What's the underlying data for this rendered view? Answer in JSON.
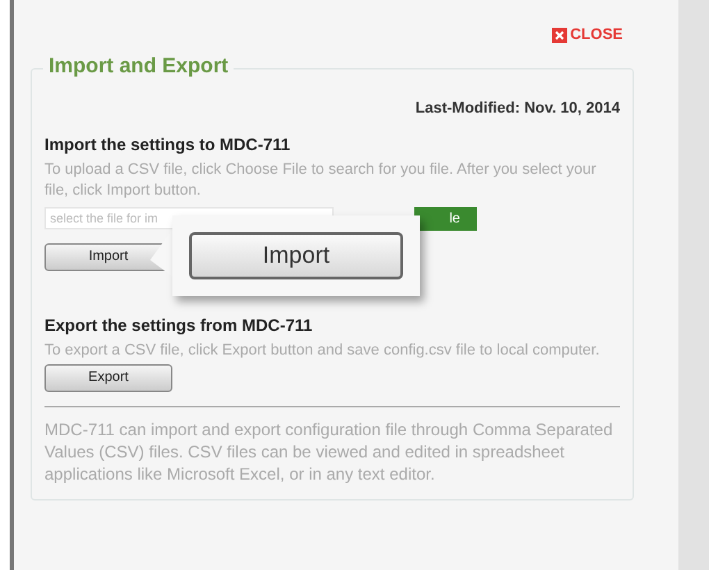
{
  "close_button": {
    "label": "CLOSE"
  },
  "panel": {
    "title": "Import and Export",
    "last_modified": "Last-Modified: Nov. 10, 2014"
  },
  "import_section": {
    "heading": "Import the settings to MDC-711",
    "description": "To upload a CSV file, click Choose File to search for you file. After you select your file, click Import button.",
    "file_field": {
      "placeholder": "select the file for im"
    },
    "choose_button": {
      "label": "le"
    },
    "import_button": {
      "label": "Import"
    }
  },
  "callout": {
    "button_label": "Import"
  },
  "export_section": {
    "heading": "Export the settings from MDC-711",
    "description": "To export a CSV file, click Export button and save config.csv file to local computer.",
    "export_button": {
      "label": "Export"
    }
  },
  "footer_note": "MDC-711 can import and export configuration file through Comma Separated Values (CSV) files. CSV files can be viewed and edited in spreadsheet applications like Microsoft Excel, or in any text editor."
}
